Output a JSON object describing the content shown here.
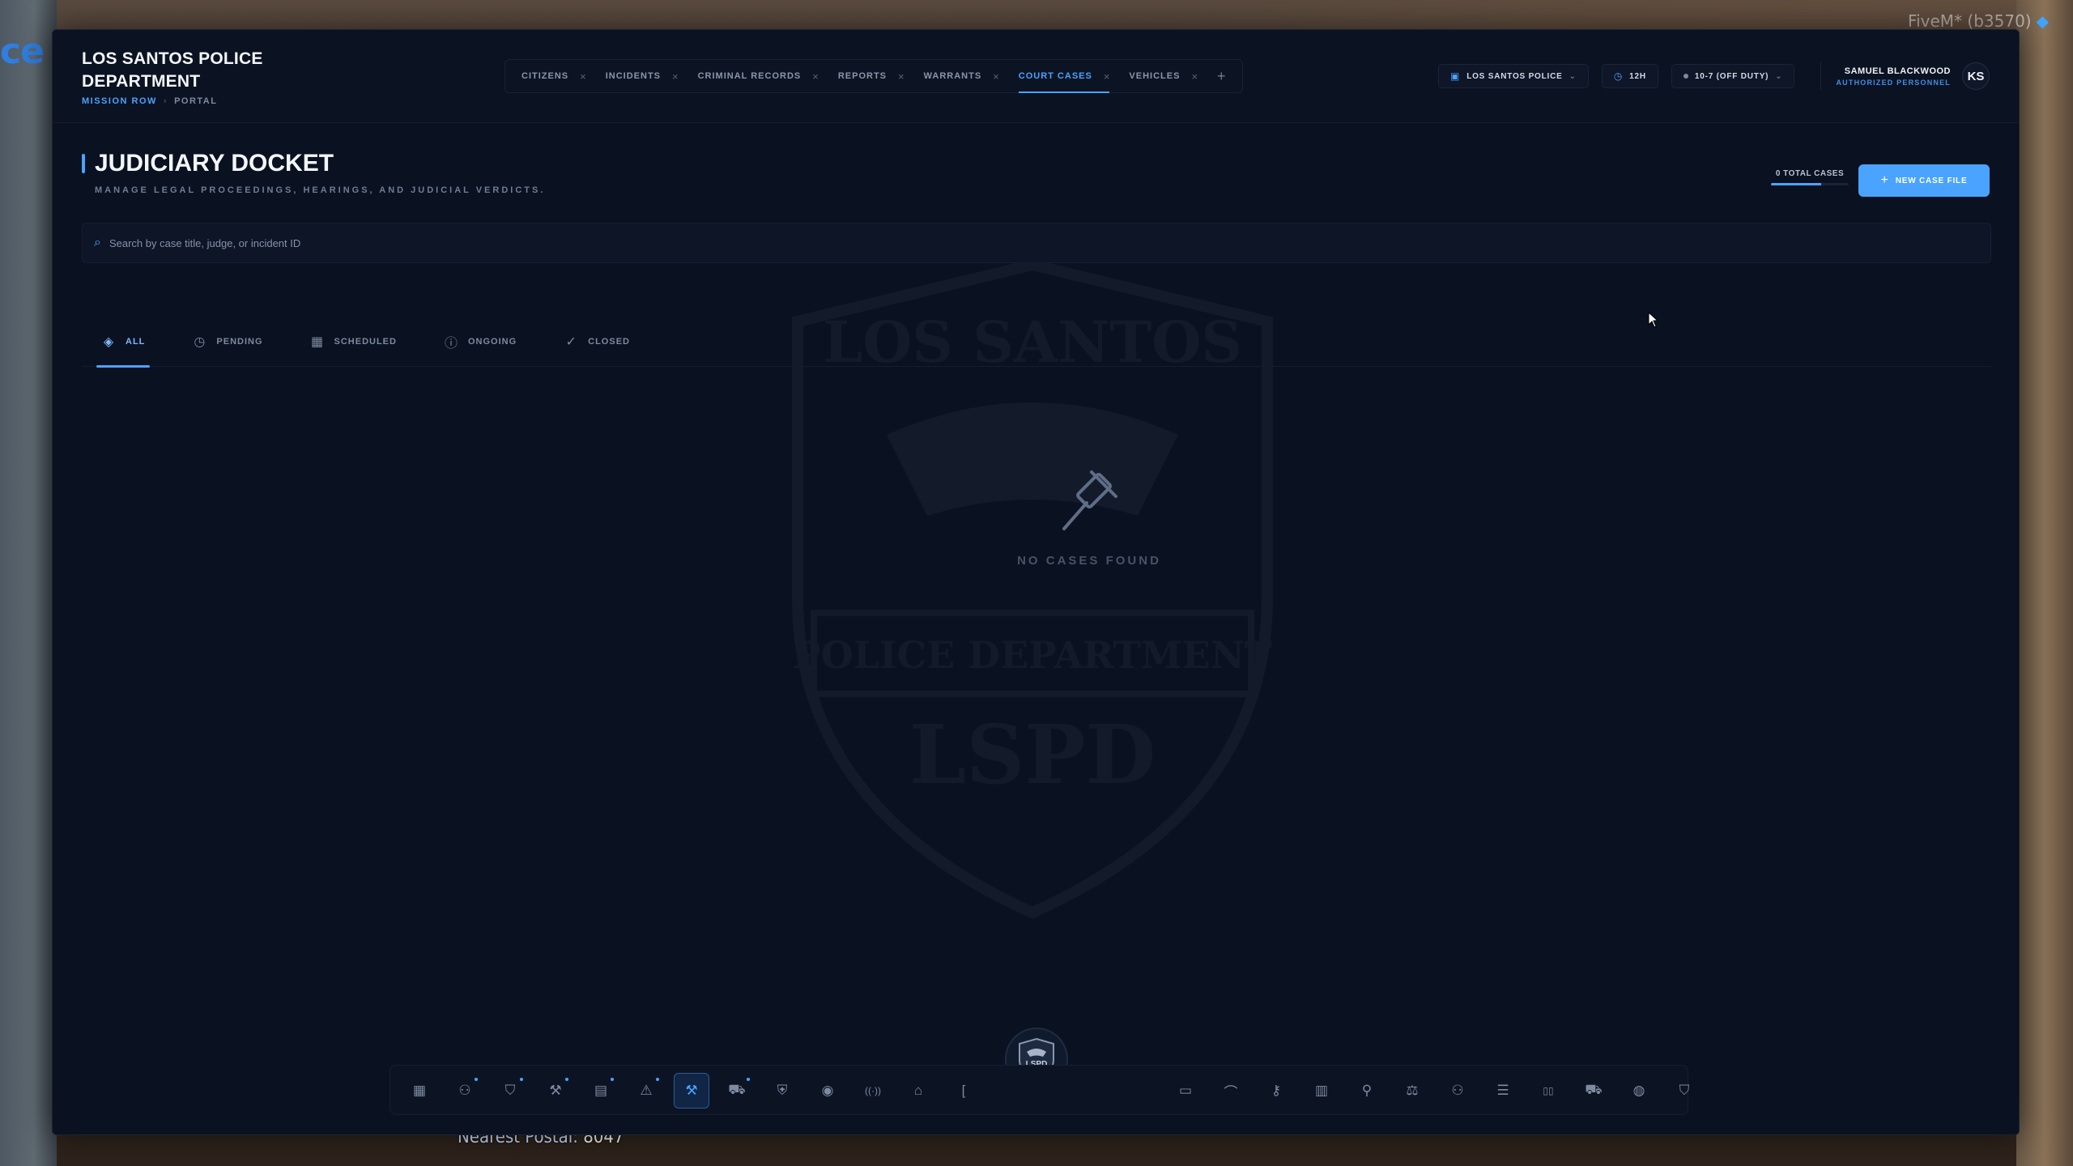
{
  "overlay": {
    "fivem_tag": "_FiveM* (b3570)",
    "side_text": "ce S",
    "postal_label": "Nearest Postal:",
    "postal_value": "8047"
  },
  "brand": {
    "title": "LOS SANTOS POLICE DEPARTMENT",
    "location": "MISSION ROW",
    "separator": "›",
    "portal": "PORTAL"
  },
  "tabs": [
    {
      "label": "CITIZENS",
      "active": false
    },
    {
      "label": "INCIDENTS",
      "active": false
    },
    {
      "label": "CRIMINAL RECORDS",
      "active": false
    },
    {
      "label": "REPORTS",
      "active": false
    },
    {
      "label": "WARRANTS",
      "active": false
    },
    {
      "label": "COURT CASES",
      "active": true
    },
    {
      "label": "VEHICLES",
      "active": false
    }
  ],
  "header_right": {
    "department": "LOS SANTOS POLICE",
    "clock": "12H",
    "status": "10-7 (OFF DUTY)",
    "user_name": "SAMUEL BLACKWOOD",
    "user_role": "AUTHORIZED PERSONNEL",
    "avatar_initials": "KS"
  },
  "page": {
    "title": "JUDICIARY DOCKET",
    "subtitle": "MANAGE LEGAL PROCEEDINGS, HEARINGS, AND JUDICIAL VERDICTS.",
    "total_cases": "0 TOTAL CASES",
    "new_case_label": "NEW CASE FILE",
    "search_placeholder": "Search by case title, judge, or incident ID"
  },
  "filters": [
    {
      "label": "ALL",
      "icon": "layers-icon",
      "active": true
    },
    {
      "label": "PENDING",
      "icon": "clock-icon",
      "active": false
    },
    {
      "label": "SCHEDULED",
      "icon": "calendar-icon",
      "active": false
    },
    {
      "label": "ONGOING",
      "icon": "alert-circle-icon",
      "active": false
    },
    {
      "label": "CLOSED",
      "icon": "check-circle-icon",
      "active": false
    }
  ],
  "empty_state": {
    "text": "NO CASES FOUND",
    "icon": "gavel-icon"
  },
  "watermark": {
    "top_text": "LOS SANTOS",
    "band_text": "POLICE DEPARTMENT",
    "bottom_text": "LSPD"
  },
  "dock": {
    "emblem": "LSPD",
    "left_icons": [
      "dashboard-icon",
      "users-icon",
      "shield-icon",
      "gavel-icon",
      "file-icon",
      "warning-icon",
      "gavel-active-icon",
      "car-icon",
      "badge-icon",
      "camera-icon",
      "radio-icon",
      "home-icon",
      "bracket-icon"
    ],
    "right_icons": [
      "message-icon",
      "graduation-icon",
      "key-icon",
      "briefcase-icon",
      "user-plus-icon",
      "scale-icon",
      "people-icon",
      "database-icon",
      "book-icon",
      "truck-icon",
      "palette-icon",
      "shield-check-icon"
    ],
    "active_index": 6
  },
  "colors": {
    "accent": "#4aa3ff",
    "panel": "#0a1120",
    "text_muted": "#7d8aa0"
  }
}
